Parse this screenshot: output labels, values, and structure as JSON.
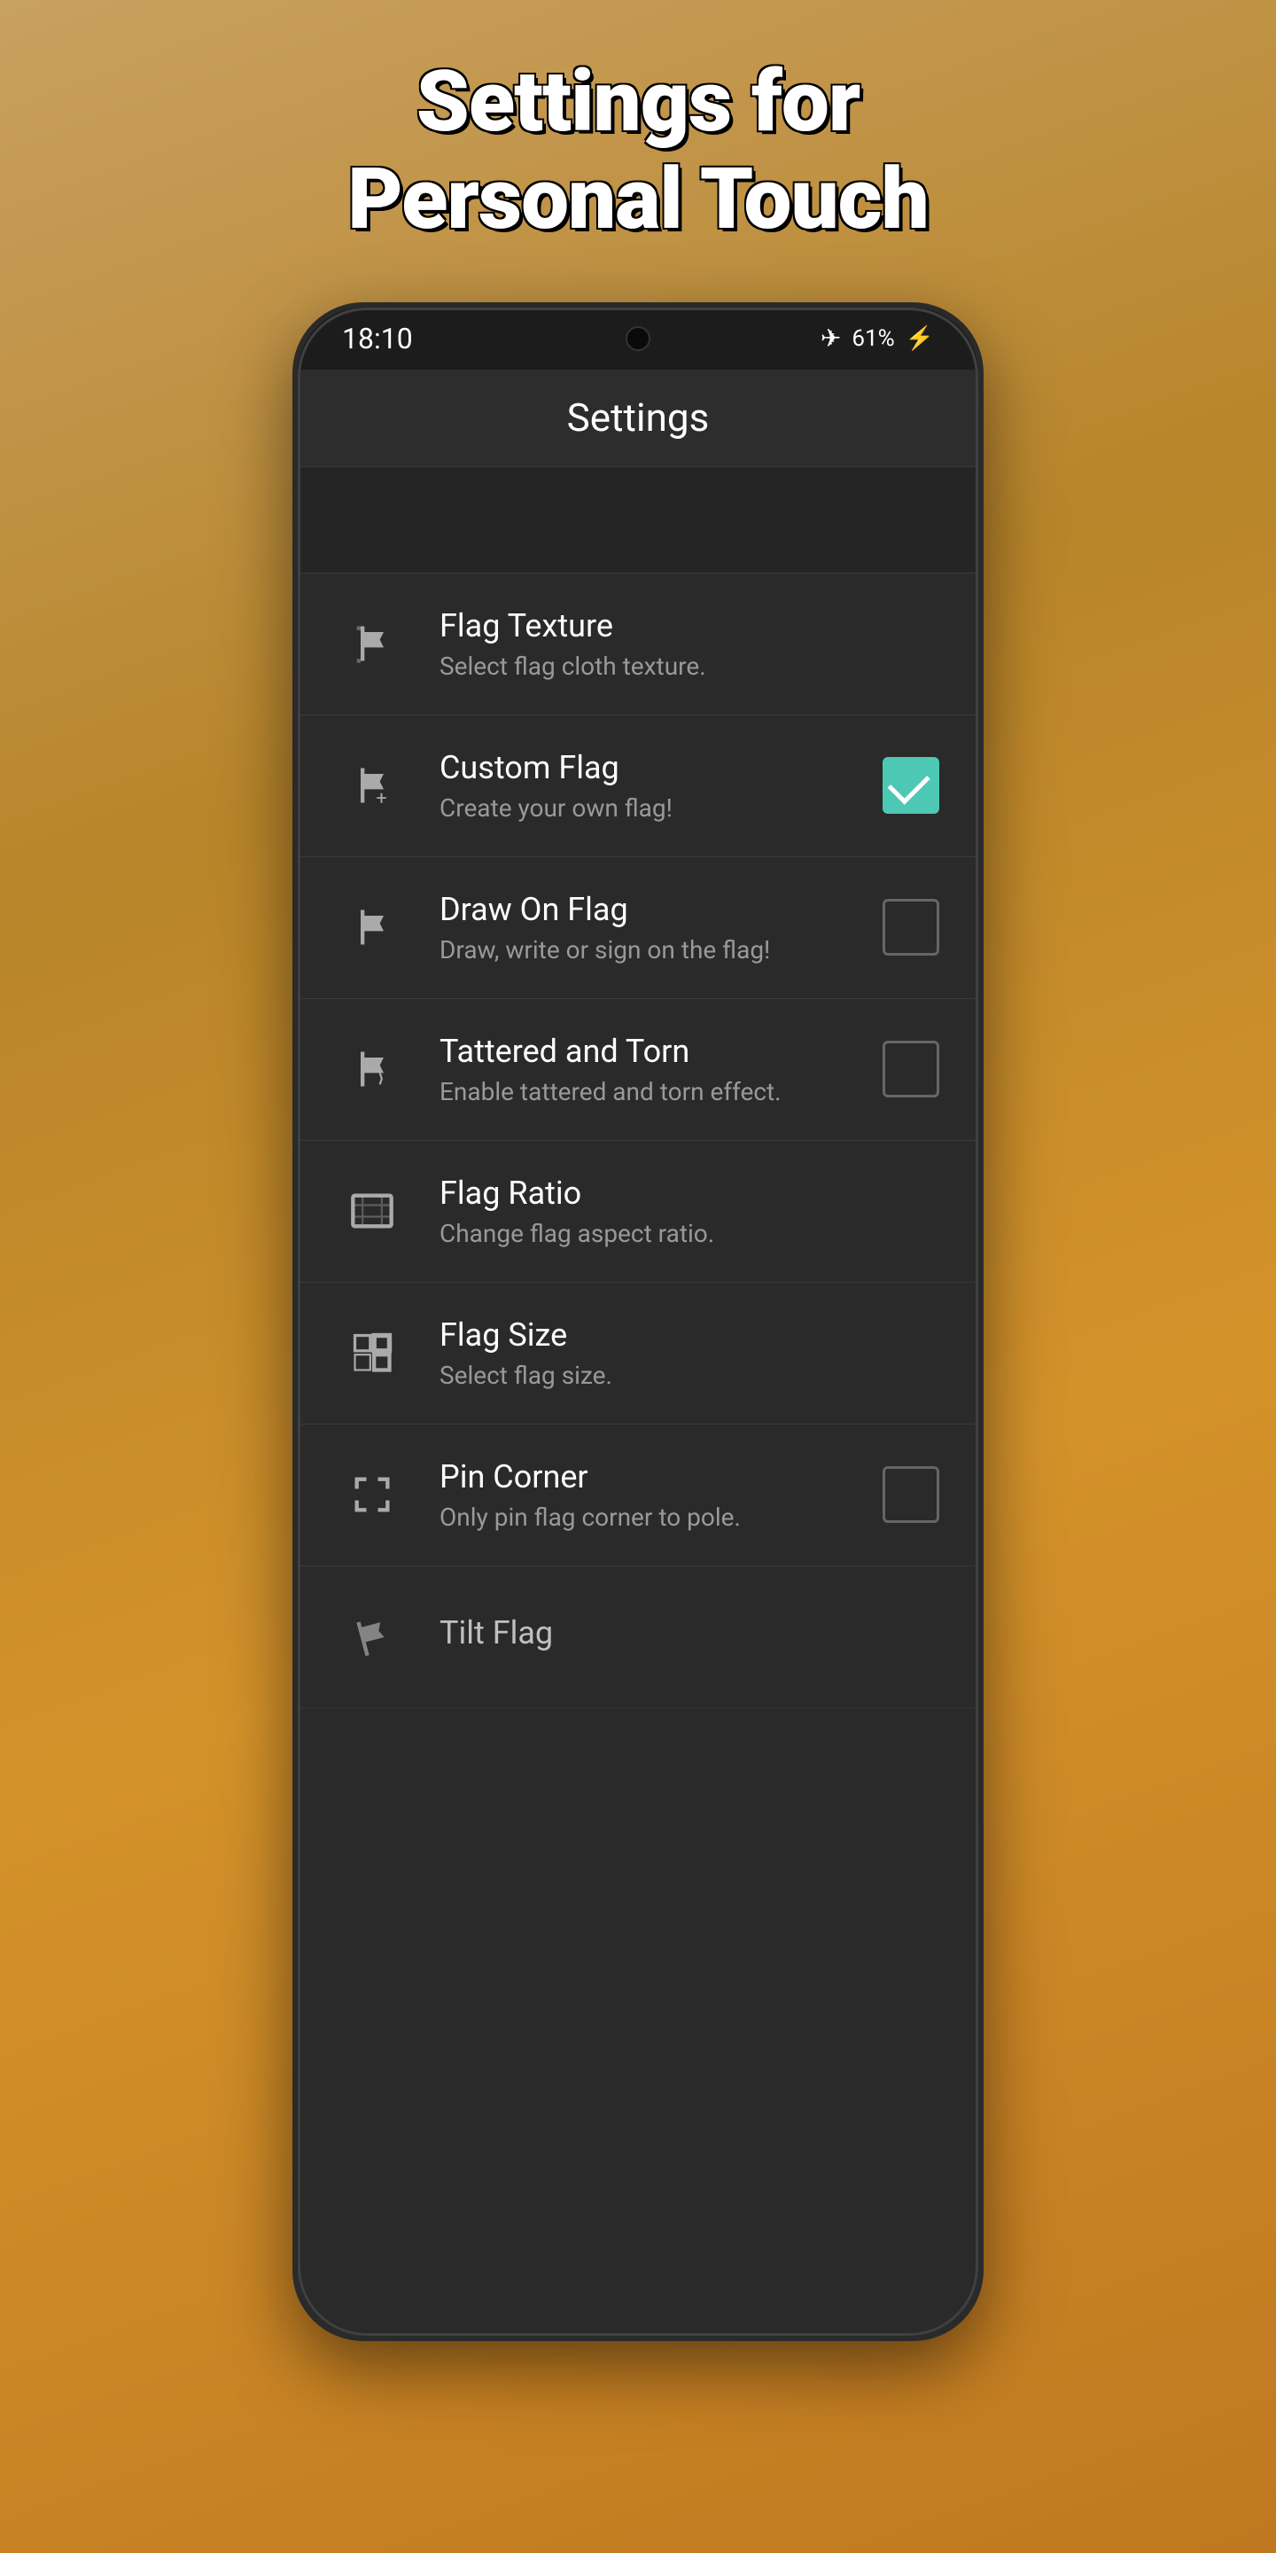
{
  "hero": {
    "title_line1": "Settings for",
    "title_line2": "Personal Touch"
  },
  "statusBar": {
    "time": "18:10",
    "battery": "61%",
    "battery_icon": "⚡",
    "wifi_icon": "✈"
  },
  "appBar": {
    "title": "Settings"
  },
  "settings": {
    "items": [
      {
        "id": "flag-texture",
        "title": "Flag Texture",
        "subtitle": "Select flag cloth texture.",
        "has_checkbox": false,
        "checked": false
      },
      {
        "id": "custom-flag",
        "title": "Custom Flag",
        "subtitle": "Create your own flag!",
        "has_checkbox": true,
        "checked": true
      },
      {
        "id": "draw-on-flag",
        "title": "Draw On Flag",
        "subtitle": "Draw, write or sign on the flag!",
        "has_checkbox": true,
        "checked": false
      },
      {
        "id": "tattered-torn",
        "title": "Tattered and Torn",
        "subtitle": "Enable tattered and torn effect.",
        "has_checkbox": true,
        "checked": false
      },
      {
        "id": "flag-ratio",
        "title": "Flag Ratio",
        "subtitle": "Change flag aspect ratio.",
        "has_checkbox": false,
        "checked": false
      },
      {
        "id": "flag-size",
        "title": "Flag Size",
        "subtitle": "Select flag size.",
        "has_checkbox": false,
        "checked": false
      },
      {
        "id": "pin-corner",
        "title": "Pin Corner",
        "subtitle": "Only pin flag corner to pole.",
        "has_checkbox": true,
        "checked": false
      },
      {
        "id": "tilt-flag",
        "title": "Tilt Flag",
        "subtitle": "",
        "has_checkbox": false,
        "checked": false
      }
    ]
  }
}
